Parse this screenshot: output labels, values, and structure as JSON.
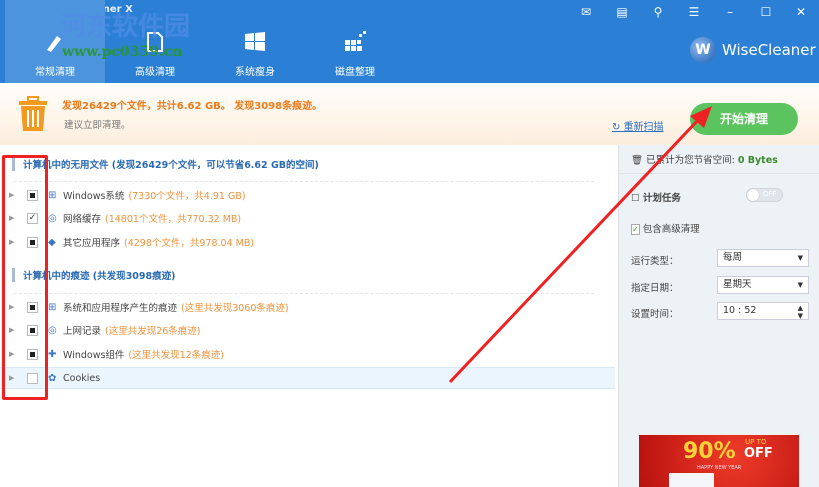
{
  "window": {
    "title": "Wise Disk Cleaner X",
    "brand": "WiseCleaner",
    "brand_letter": "W"
  },
  "watermark": {
    "line1": "河东软件园",
    "line2": "www.pc0359.cn"
  },
  "tabs": [
    {
      "label": "常规清理",
      "active": true
    },
    {
      "label": "高级清理"
    },
    {
      "label": "系统瘦身"
    },
    {
      "label": "磁盘整理"
    }
  ],
  "window_controls": [
    "mail-icon",
    "feedback-icon",
    "tools-icon",
    "menu-icon",
    "minimize",
    "maximize",
    "close"
  ],
  "banner": {
    "found": "发现26429个文件，共计6.62 GB。 发现3098条痕迹。",
    "suggest": "建议立即清理。",
    "rescan": "重新扫描",
    "start": "开始清理"
  },
  "sections": [
    {
      "title": "计算机中的无用文件 (发现26429个文件，可以节省6.62 GB的空间)",
      "items": [
        {
          "name": "Windows系统",
          "info": "(7330个文件，共4.91 GB)",
          "state": "partial"
        },
        {
          "name": "网络缓存",
          "info": "(14801个文件，共770.32 MB)",
          "state": "checked"
        },
        {
          "name": "其它应用程序",
          "info": "(4298个文件，共978.04 MB)",
          "state": "partial"
        }
      ]
    },
    {
      "title": "计算机中的痕迹 (共发现3098痕迹)",
      "items": [
        {
          "name": "系统和应用程序产生的痕迹",
          "info": "(这里共发现3060条痕迹)",
          "state": "partial"
        },
        {
          "name": "上网记录",
          "info": "(这里共发现26条痕迹)",
          "state": "partial"
        },
        {
          "name": "Windows组件",
          "info": "(这里共发现12条痕迹)",
          "state": "partial"
        },
        {
          "name": "Cookies",
          "info": "",
          "state": "unchecked"
        }
      ]
    }
  ],
  "right": {
    "saved_label": "已累计为您节省空间:",
    "saved_value": "0 Bytes",
    "schedule": "计划任务",
    "toggle": "OFF",
    "include_adv": "包含高级清理",
    "run_type_label": "运行类型：",
    "run_type": "每周",
    "date_label": "指定日期：",
    "date": "星期天",
    "time_label": "设置时间：",
    "time": "10 : 52"
  },
  "ad": {
    "pct": "90%",
    "up_to": "UP TO",
    "off": "OFF",
    "sub": "HAPPY NEW YEAR"
  },
  "colors": {
    "titlebar": "#2b80d5",
    "start": "#5bc45f",
    "orange": "#ee7a1a"
  }
}
